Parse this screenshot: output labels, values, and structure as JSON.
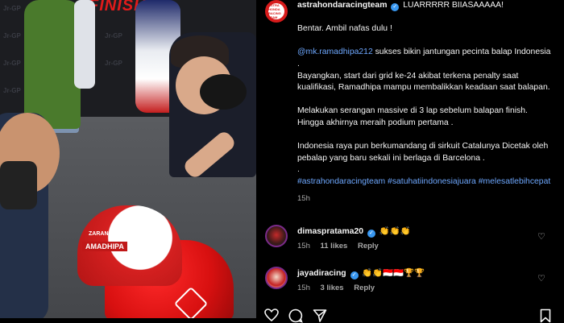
{
  "photo": {
    "banner_text": "FINISH ! !",
    "wall_logo": "Jr-GP",
    "helmet_label": "AMADHIPA",
    "helmet_sponsor": "ZARAN"
  },
  "post": {
    "author": "astrahondaracingteam",
    "avatar_text": "ASTRA HONDA RACING TEAM",
    "caption_lines": [
      {
        "type": "lead",
        "text": "LUARRRRR BIIASAAAAA!"
      },
      {
        "type": "gap"
      },
      {
        "type": "text",
        "text": "Bentar. Ambil nafas dulu !"
      },
      {
        "type": "gap"
      },
      {
        "type": "mention",
        "mention": "@mk.ramadhipa212",
        "text": " sukses bikin jantungan pecinta balap Indonesia ."
      },
      {
        "type": "text",
        "text": "Bayangkan, start dari grid ke-24 akibat terkena penalty saat kualifikasi, Ramadhipa mampu membalikkan keadaan saat balapan."
      },
      {
        "type": "gap"
      },
      {
        "type": "text",
        "text": "Melakukan serangan massive di 3 lap sebelum balapan finish. Hingga akhirnya meraih podium pertama ."
      },
      {
        "type": "gap"
      },
      {
        "type": "text",
        "text": "Indonesia raya pun berkumandang di sirkuit Catalunya Dicetak oleh pebalap yang baru sekali ini berlaga di Barcelona ."
      },
      {
        "type": "text",
        "text": "."
      },
      {
        "type": "tags",
        "text": "#astrahondaracingteam #satuhatiindonesiajuara #melesatlebihcepat"
      }
    ],
    "time": "15h"
  },
  "comments": [
    {
      "username": "dimaspratama20",
      "verified": true,
      "text": "👏👏👏",
      "time": "15h",
      "likes": "11 likes",
      "reply": "Reply"
    },
    {
      "username": "jayadiracing",
      "verified": true,
      "text": "👏👏🇮🇩🇮🇩🏆🏆",
      "time": "15h",
      "likes": "3 likes",
      "reply": "Reply"
    }
  ],
  "icons": {
    "heart": "heart-icon",
    "comment": "comment-icon",
    "share": "share-icon",
    "bookmark": "bookmark-icon",
    "verified": "verified-icon"
  },
  "colors": {
    "verified": "#3897f0",
    "link": "#6ea8ff",
    "muted": "#a8a8a8",
    "background": "#000000",
    "brand_red": "#d71b1b"
  }
}
